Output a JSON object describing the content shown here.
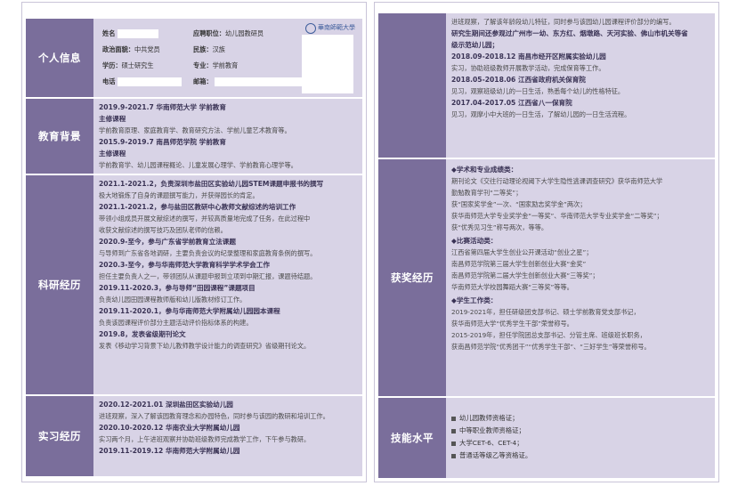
{
  "left": {
    "personal": {
      "label": "个人信息",
      "name_key": "姓名",
      "position_key": "应聘职位：",
      "position_val": "幼儿园教研员",
      "political_key": "政治面貌：",
      "political_val": "中共党员",
      "ethnic_key": "民族：",
      "ethnic_val": "汉族",
      "degree_key": "学历：",
      "degree_val": "硕士研究生",
      "major_key": "专业：",
      "major_val": "学前教育",
      "phone_key": "电话",
      "email_key": "邮箱：",
      "logo_text": "華南師範大學"
    },
    "education": {
      "label": "教育背景",
      "lines": [
        {
          "type": "b",
          "text": "2019.9-2021.7          华南师范大学          学前教育"
        },
        {
          "type": "b",
          "text": "主修课程"
        },
        {
          "type": "t",
          "text": "学前教育原理、家庭教育学、教育研究方法、学前儿童艺术教育等。"
        },
        {
          "type": "b",
          "text": "2015.9-2019.7          南昌师范学院          学前教育"
        },
        {
          "type": "b",
          "text": "主修课程"
        },
        {
          "type": "t",
          "text": "学前教育学、幼儿园课程概论、儿童发展心理学、学前教育心理学等。"
        }
      ]
    },
    "research": {
      "label": "科研经历",
      "lines": [
        {
          "type": "b",
          "text": "2021.1-2021.2，负责深圳市盐田区实验幼儿园STEM课题申报书的撰写"
        },
        {
          "type": "t",
          "text": "极大地锻炼了自身的课题撰写能力，并获得园长的肯定。"
        },
        {
          "type": "b",
          "text": "2021.1-2021.2，参与盐田区教研中心教师文献综述的培训工作"
        },
        {
          "type": "t",
          "text": "带领小组成员开展文献综述的撰写，并较高质量地完成了任务，在此过程中"
        },
        {
          "type": "t",
          "text": "收获文献综述的撰写技巧及团队老师的信赖。"
        },
        {
          "type": "b",
          "text": "2020.9-至今，参与广东省学前教育立法课题"
        },
        {
          "type": "t",
          "text": "与导师到广东省各地调研，主要负责会议的纪录整理和家庭教育条例的撰写。"
        },
        {
          "type": "b",
          "text": "2020.3-至今，参与华南师范大学教育科学学术学会工作"
        },
        {
          "type": "t",
          "text": "担任主要负责人之一，带领团队从课题申报到立项到中期汇报，课题待结题。"
        },
        {
          "type": "b",
          "text": "2019.11-2020.3，参与导师“田园课程”课题项目"
        },
        {
          "type": "t",
          "text": "负责幼儿园田园课程教师版和幼儿版教材修订工作。"
        },
        {
          "type": "b",
          "text": "2019.11-2020.1，参与华南师范大学附属幼儿园园本课程"
        },
        {
          "type": "t",
          "text": "负责该园课程评价部分主题活动评价指标体系的构建。"
        },
        {
          "type": "b",
          "text": "2019.8，发表省级期刊论文"
        },
        {
          "type": "t",
          "text": "发表《移动学习背景下幼儿教师教学设计能力的调查研究》省级期刊论文。"
        }
      ]
    },
    "internship": {
      "label": "实习经历",
      "lines": [
        {
          "type": "b",
          "text": "2020.12-2021.01          深圳盐田区实验幼儿园"
        },
        {
          "type": "t",
          "text": "进班观察，深入了解该园教育理念和办园特色，同时参与该园的教研和培训工作。"
        },
        {
          "type": "b",
          "text": "2020.10-2020.12          华南农业大学附属幼儿园"
        },
        {
          "type": "t",
          "text": "实习两个月，上午进班观察并协助班级教师完成教学工作，下午参与教研。"
        },
        {
          "type": "b",
          "text": "2019.11-2019.12          华南师范大学附属幼儿园"
        }
      ]
    }
  },
  "right": {
    "internship_cont": {
      "lines": [
        {
          "type": "t",
          "text": "进班观察，了解该年龄段幼儿特征，同时参与该园幼儿园课程评价部分的编写。"
        },
        {
          "type": "b",
          "text": "研究生期间还参观过广州市一幼、东方红、烟墩路、天河实验、佛山市机关等省"
        },
        {
          "type": "b",
          "text": "级示范幼儿园；"
        },
        {
          "type": "b",
          "text": "2018.09-2018.12          南昌市经开区附属实验幼儿园"
        },
        {
          "type": "t",
          "text": "实习，协助班级教师开展教学活动，完成保育等工作。"
        },
        {
          "type": "b",
          "text": "2018.05-2018.06          江西省政府机关保育院"
        },
        {
          "type": "t",
          "text": "见习，观察班级幼儿的一日生活，熟悉每个幼儿的性格特征。"
        },
        {
          "type": "b",
          "text": "2017.04-2017.05          江西省八一保育院"
        },
        {
          "type": "t",
          "text": "见习，观摩小中大班的一日生活，了解幼儿园的一日生活流程。"
        }
      ]
    },
    "awards": {
      "label": "获奖经历",
      "lines": [
        {
          "type": "h",
          "text": "学术和专业成绩类："
        },
        {
          "type": "t",
          "text": "期刊论文《交往行动理论视阈下大学生隐性逃课调查研究》获华南师范大学"
        },
        {
          "type": "t",
          "text": "勤勉教育学刊“二等奖”；"
        },
        {
          "type": "t",
          "text": "获“国家奖学金”一次、“国家励志奖学金”两次；"
        },
        {
          "type": "t",
          "text": "获华南师范大学专业奖学金“一等奖”、华南师范大学专业奖学金“二等奖”；"
        },
        {
          "type": "t",
          "text": "获“优秀见习生”称号两次，等等。"
        },
        {
          "type": "h",
          "text": "比赛活动类："
        },
        {
          "type": "t",
          "text": "江西省第四届大学生创业公开课活动“创业之星”；"
        },
        {
          "type": "t",
          "text": "南昌师范学院第三届大学生创新创业大赛“金奖”"
        },
        {
          "type": "t",
          "text": "南昌师范学院第二届大学生创新创业大赛“三等奖”；"
        },
        {
          "type": "t",
          "text": "华南师范大学校园舞蹈大赛“三等奖”等等。"
        },
        {
          "type": "h",
          "text": "学生工作类："
        },
        {
          "type": "t",
          "text": "2019-2021年，担任研级团支部书记、硕士学前教育党支部书记，"
        },
        {
          "type": "t",
          "text": "获华南师范大学“优秀学生干部”荣誉称号。"
        },
        {
          "type": "t",
          "text": "2015-2019年，担任学院团总支部书记、分管主席、班级班长职务，"
        },
        {
          "type": "t",
          "text": "获南昌师范学院“优秀团干”“优秀学生干部”、“三好学生”等荣誉称号。"
        }
      ]
    },
    "skills": {
      "label": "技能水平",
      "items": [
        "幼儿园教师资格证；",
        "中等职业教师资格证；",
        "大学CET-6、CET-4；",
        "普通话等级乙等资格证。"
      ]
    }
  }
}
